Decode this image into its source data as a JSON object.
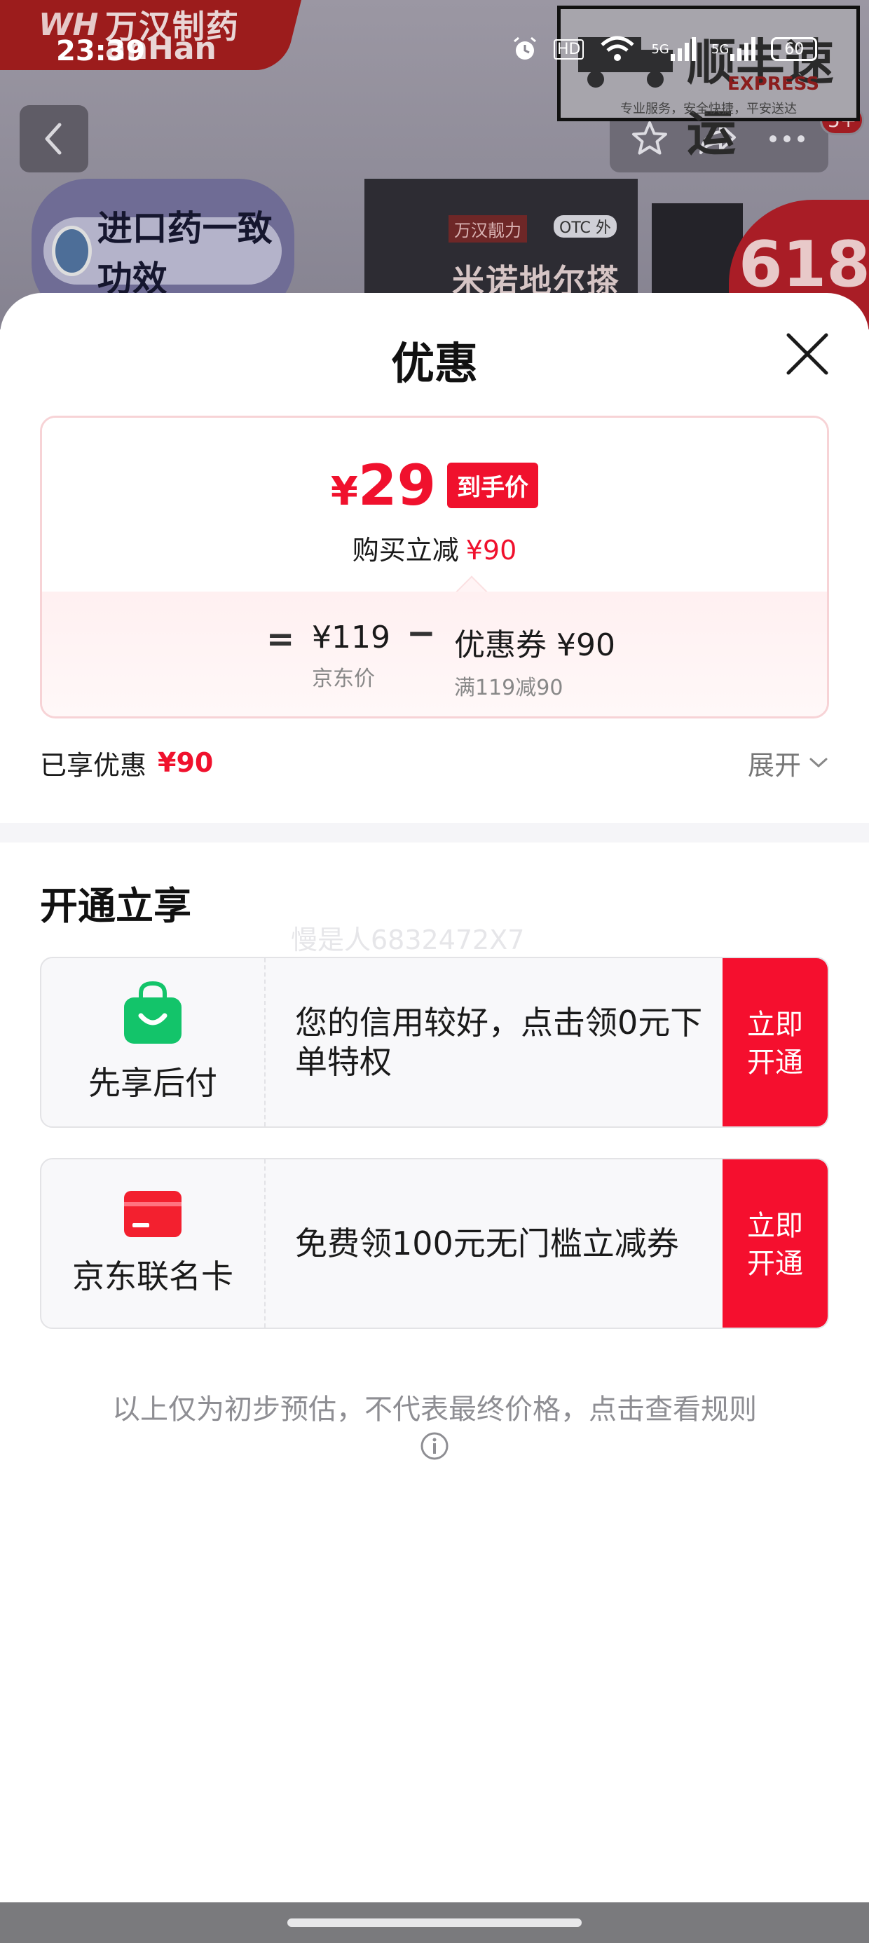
{
  "status_bar": {
    "time": "23:39",
    "hd_label": "HD",
    "signal1_label": "5G",
    "signal2_label": "5G",
    "battery": "60"
  },
  "background": {
    "brand_logo": "WH",
    "brand_name": "万汉制药",
    "brand_en": "anHan",
    "sf_main": "顺丰速运",
    "sf_express": "EXPRESS",
    "sf_small": "专业服务，安全快捷，平安送达",
    "pill_text": "进口药一致功效",
    "box_brand": "万汉靓力",
    "box_otc": "OTC 外",
    "box_name": "米诺地尔搽剂",
    "promo_618": "618",
    "notification_count": "5+"
  },
  "sheet": {
    "title": "优惠",
    "final_price": {
      "currency": "¥",
      "amount": "29",
      "tag": "到手价"
    },
    "discount": {
      "label": "购买立减",
      "amount": "¥90"
    },
    "calc": {
      "equals": "=",
      "jd_price": "¥119",
      "jd_price_label": "京东价",
      "minus": "−",
      "coupon": "优惠券 ¥90",
      "coupon_label": "满119减90"
    },
    "enjoyed": {
      "label": "已享优惠",
      "amount": "¥90",
      "expand_label": "展开"
    },
    "section_title": "开通立享",
    "watermark": "慢是人6832472X7",
    "promos": [
      {
        "name": "先享后付",
        "description": "您的信用较好，点击领0元下单特权",
        "button": "立即开通",
        "icon": "shopping-bag-icon",
        "color": "#13c46a"
      },
      {
        "name": "京东联名卡",
        "description": "免费领100元无门槛立减券",
        "button": "立即开通",
        "icon": "credit-card-icon",
        "color": "#f3202f"
      }
    ],
    "footer_note": "以上仅为初步预估，不代表最终价格，点击查看规则"
  },
  "colors": {
    "accent_red": "#f0112d",
    "button_red": "#f50f2e"
  }
}
